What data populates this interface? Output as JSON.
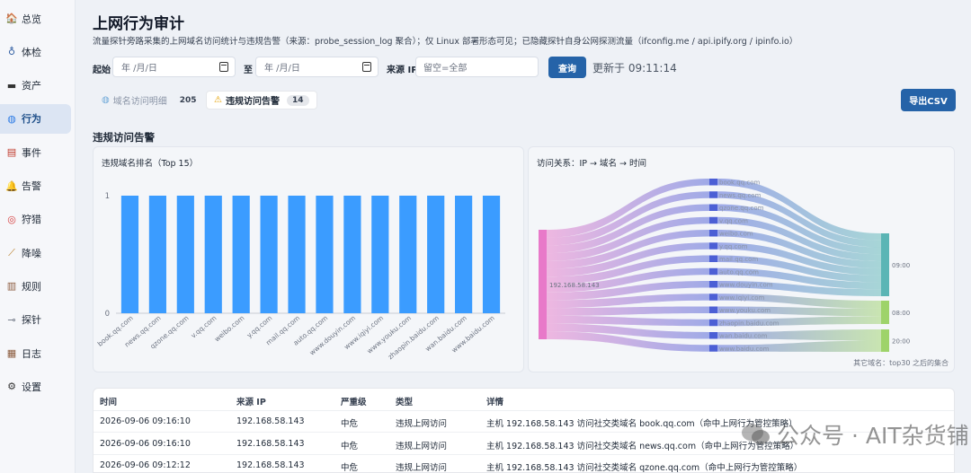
{
  "sidebar": {
    "items": [
      {
        "label": "总览",
        "icon": "home-icon",
        "active": false
      },
      {
        "label": "体检",
        "icon": "stethoscope-icon",
        "active": false
      },
      {
        "label": "资产",
        "icon": "truck-icon",
        "active": false
      },
      {
        "label": "行为",
        "icon": "globe-icon",
        "active": true
      },
      {
        "label": "事件",
        "icon": "document-icon",
        "active": false
      },
      {
        "label": "告警",
        "icon": "bell-icon",
        "active": false
      },
      {
        "label": "狩猎",
        "icon": "target-icon",
        "active": false
      },
      {
        "label": "降噪",
        "icon": "broom-icon",
        "active": false
      },
      {
        "label": "规则",
        "icon": "clipboard-icon",
        "active": false
      },
      {
        "label": "探针",
        "icon": "syringe-icon",
        "active": false
      },
      {
        "label": "日志",
        "icon": "log-icon",
        "active": false
      },
      {
        "label": "设置",
        "icon": "gear-icon",
        "active": false
      }
    ]
  },
  "page": {
    "title": "上网行为审计",
    "subtitle": "流量探针旁路采集的上网域名访问统计与违规告警（来源：probe_session_log 聚合）；仅 Linux 部署形态可见；已隐藏探针自身公网探测流量（ifconfig.me / api.ipify.org / ipinfo.io）"
  },
  "filters": {
    "start_label": "起始",
    "start_placeholder": "年 /月/日",
    "to_label": "至",
    "end_placeholder": "年 /月/日",
    "ip_label": "来源 IP",
    "ip_placeholder": "留空=全部",
    "query_button": "查询",
    "updated_text": "更新于 09:11:14"
  },
  "tabs": [
    {
      "label": "域名访问明细",
      "count": "205",
      "icon": "globe-icon",
      "active": false
    },
    {
      "label": "违规访问告警",
      "count": "14",
      "icon": "warning-icon",
      "active": true
    }
  ],
  "export_button": "导出CSV",
  "section_title": "违规访问告警",
  "bar_panel": {
    "title": "违规域名排名（Top 15）"
  },
  "sankey_panel": {
    "title": "访问关系：IP → 域名 → 时间",
    "footnote": "其它域名：top30 之后的集合",
    "source": "192.168.58.143",
    "domains": [
      "book.qq.com",
      "news.qq.com",
      "qzone.qq.com",
      "v.qq.com",
      "weibo.com",
      "y.qq.com",
      "mail.qq.com",
      "auto.qq.com",
      "www.douyin.com",
      "www.iqiyi.com",
      "www.youku.com",
      "zhaopin.baidu.com",
      "wan.baidu.com",
      "www.baidu.com"
    ],
    "times": [
      "09:00",
      "08:00",
      "20:00"
    ],
    "colors": {
      "source": "#e879c9",
      "domain": "#4c5fd5",
      "t0900": "#5bb5b5",
      "t0800": "#9ed36a",
      "t2000": "#9ed36a"
    }
  },
  "chart_data": {
    "type": "bar",
    "title": "违规域名排名（Top 15）",
    "categories": [
      "book.qq.com",
      "news.qq.com",
      "qzone.qq.com",
      "v.qq.com",
      "weibo.com",
      "y.qq.com",
      "mail.qq.com",
      "auto.qq.com",
      "www.douyin.com",
      "www.iqiyi.com",
      "www.youku.com",
      "zhaopin.baidu.com",
      "wan.baidu.com",
      "www.baidu.com"
    ],
    "values": [
      1,
      1,
      1,
      1,
      1,
      1,
      1,
      1,
      1,
      1,
      1,
      1,
      1,
      1
    ],
    "ylim": [
      0,
      1
    ],
    "yticks": [
      "0",
      "1"
    ],
    "color": "#3b9cff",
    "grid": false
  },
  "table": {
    "headers": [
      "时间",
      "来源 IP",
      "严重级",
      "类型",
      "详情"
    ],
    "rows": [
      [
        "2026-09-06 09:16:10",
        "192.168.58.143",
        "中危",
        "违规上网访问",
        "主机 192.168.58.143 访问社交类域名 book.qq.com（命中上网行为管控策略）"
      ],
      [
        "2026-09-06 09:16:10",
        "192.168.58.143",
        "中危",
        "违规上网访问",
        "主机 192.168.58.143 访问社交类域名 news.qq.com（命中上网行为管控策略）"
      ],
      [
        "2026-09-06 09:12:12",
        "192.168.58.143",
        "中危",
        "违规上网访问",
        "主机 192.168.58.143 访问社交类域名 qzone.qq.com（命中上网行为管控策略）"
      ]
    ]
  },
  "watermark": "公众号 · AIT杂货铺"
}
